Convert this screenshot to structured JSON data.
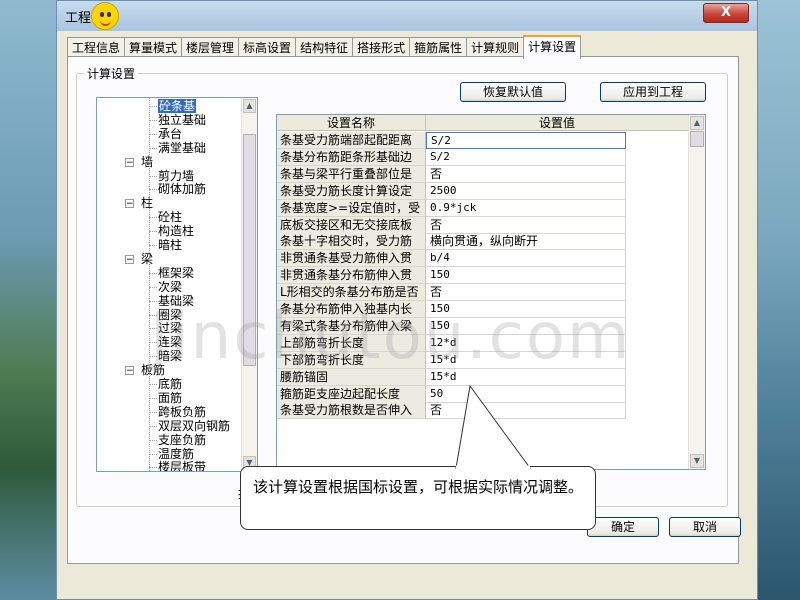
{
  "window": {
    "title": "工程",
    "close_label": "X"
  },
  "tabs": [
    {
      "label": "工程信息"
    },
    {
      "label": "算量模式"
    },
    {
      "label": "楼层管理"
    },
    {
      "label": "标高设置"
    },
    {
      "label": "结构特征"
    },
    {
      "label": "搭接形式"
    },
    {
      "label": "箍筋属性"
    },
    {
      "label": "计算规则"
    },
    {
      "label": "计算设置",
      "active": true
    }
  ],
  "settings_group": {
    "label": "计算设置",
    "restore_default_label": "恢复默认值",
    "apply_to_project_label": "应用到工程"
  },
  "tree": {
    "nodes": [
      {
        "label": "砼条基",
        "level": 1,
        "selected": true
      },
      {
        "label": "独立基础",
        "level": 1
      },
      {
        "label": "承台",
        "level": 1
      },
      {
        "label": "满堂基础",
        "level": 1
      },
      {
        "label": "墙",
        "level": 0,
        "expander": "−"
      },
      {
        "label": "剪力墙",
        "level": 1
      },
      {
        "label": "砌体加筋",
        "level": 1
      },
      {
        "label": "柱",
        "level": 0,
        "expander": "−"
      },
      {
        "label": "砼柱",
        "level": 1
      },
      {
        "label": "构造柱",
        "level": 1
      },
      {
        "label": "暗柱",
        "level": 1
      },
      {
        "label": "梁",
        "level": 0,
        "expander": "−"
      },
      {
        "label": "框架梁",
        "level": 1
      },
      {
        "label": "次梁",
        "level": 1
      },
      {
        "label": "基础梁",
        "level": 1
      },
      {
        "label": "圈梁",
        "level": 1
      },
      {
        "label": "过梁",
        "level": 1
      },
      {
        "label": "连梁",
        "level": 1
      },
      {
        "label": "暗梁",
        "level": 1
      },
      {
        "label": "板筋",
        "level": 0,
        "expander": "−"
      },
      {
        "label": "底筋",
        "level": 1
      },
      {
        "label": "面筋",
        "level": 1
      },
      {
        "label": "跨板负筋",
        "level": 1
      },
      {
        "label": "双层双向钢筋",
        "level": 1
      },
      {
        "label": "支座负筋",
        "level": 1
      },
      {
        "label": "温度筋",
        "level": 1
      },
      {
        "label": "楼层板带",
        "level": 1
      }
    ]
  },
  "grid": {
    "headers": [
      "设置名称",
      "设置值"
    ],
    "rows": [
      {
        "name": "条基受力筋端部起配距离",
        "value": "S/2"
      },
      {
        "name": "条基分布筋距条形基础边",
        "value": "S/2"
      },
      {
        "name": "条基与梁平行重叠部位是",
        "value": "否"
      },
      {
        "name": "条基受力筋长度计算设定",
        "value": "2500"
      },
      {
        "name": "条基宽度>=设定值时，受",
        "value": "0.9*jck"
      },
      {
        "name": "底板交接区和无交接底板",
        "value": "否"
      },
      {
        "name": "条基十字相交时，受力筋",
        "value": "横向贯通，纵向断开"
      },
      {
        "name": "非贯通条基受力筋伸入贯",
        "value": "b/4"
      },
      {
        "name": "非贯通条基分布筋伸入贯",
        "value": "150"
      },
      {
        "name": "L形相交的条基分布筋是否",
        "value": "否"
      },
      {
        "name": "条基分布筋伸入独基内长",
        "value": "150"
      },
      {
        "name": "有梁式条基分布筋伸入梁",
        "value": "150"
      },
      {
        "name": "上部筋弯折长度",
        "value": "12*d"
      },
      {
        "name": "下部筋弯折长度",
        "value": "15*d"
      },
      {
        "name": "腰筋锚固",
        "value": "15*d"
      },
      {
        "name": "箍筋距支座边起配长度",
        "value": "50"
      },
      {
        "name": "条基受力筋根数是否伸入",
        "value": "否"
      }
    ]
  },
  "bottom": {
    "partial_text": "提",
    "ok_label": "确定",
    "cancel_label": "取消"
  },
  "callout": {
    "text": "该计算设置根据国标设置，可根据实际情况调整。"
  },
  "watermark": {
    "text": "Jinchutou.com"
  }
}
